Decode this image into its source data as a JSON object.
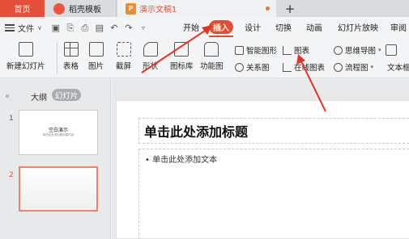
{
  "tabs": {
    "home": "首页",
    "templates": "稻壳模板",
    "document": "演示文稿1",
    "new_tab": "+"
  },
  "menubar": {
    "file": "文件",
    "file_chevron": "∨",
    "tabs": [
      "开始",
      "插入",
      "设计",
      "切换",
      "动画",
      "幻灯片放映",
      "审阅"
    ],
    "active_tab": "插入"
  },
  "ribbon": {
    "new_slide": "新建幻灯片",
    "table": "表格",
    "picture": "图片",
    "screenshot": "截屏",
    "shape": "形状",
    "icon_library": "图标库",
    "function_chart": "功能图",
    "smart_shape": "智能图形",
    "chart": "图表",
    "mind_map": "思维导图",
    "text_box": "文本框",
    "relation_chart": "关系图",
    "online_chart": "在线图表",
    "flow_chart": "流程图"
  },
  "left_panel": {
    "collapse": "«",
    "outline": "大纲",
    "slides": "幻灯片",
    "slide_numbers": [
      "1",
      "2"
    ],
    "thumb1_title": "空白演示",
    "thumb1_subtitle": "单击此处添加副标题内容"
  },
  "slide": {
    "title_placeholder": "单击此处添加标题",
    "body_placeholder": "• 单击此处添加文本"
  },
  "colors": {
    "accent": "#e84a2e",
    "annotation_arrow": "#e8321e"
  }
}
